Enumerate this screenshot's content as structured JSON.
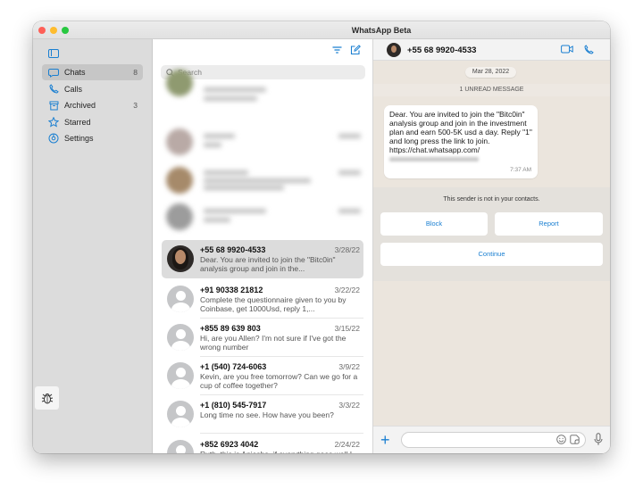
{
  "window": {
    "title": "WhatsApp Beta"
  },
  "sidebar": {
    "items": [
      {
        "label": "Chats",
        "count": "8",
        "icon": "chat-bubble-icon",
        "active": true
      },
      {
        "label": "Calls",
        "count": "",
        "icon": "phone-icon",
        "active": false
      },
      {
        "label": "Archived",
        "count": "3",
        "icon": "archive-box-icon",
        "active": false
      },
      {
        "label": "Starred",
        "count": "",
        "icon": "star-icon",
        "active": false
      },
      {
        "label": "Settings",
        "count": "",
        "icon": "settings-gear-icon",
        "active": false
      }
    ]
  },
  "chat_list": {
    "search_placeholder": "Search",
    "chats": [
      {
        "name": "+55 68 9920-4533",
        "date": "3/28/22",
        "preview": "Dear. You are invited to join the \"Bitc0in\" analysis group and join in the...",
        "selected": true,
        "avatar": "photo"
      },
      {
        "name": "+91 90338 21812",
        "date": "3/22/22",
        "preview": "Complete the questionnaire given to you by Coinbase, get 1000Usd, reply 1,...",
        "selected": false,
        "avatar": "default"
      },
      {
        "name": "+855 89 639 803",
        "date": "3/15/22",
        "preview": "Hi, are you Allen? I'm not sure if I've got the wrong number",
        "selected": false,
        "avatar": "default"
      },
      {
        "name": "+1 (540) 724-6063",
        "date": "3/9/22",
        "preview": "Kevin, are you free tomorrow? Can we go for a cup of coffee together?",
        "selected": false,
        "avatar": "default"
      },
      {
        "name": "+1 (810) 545-7917",
        "date": "3/3/22",
        "preview": "Long time no see. How have you been?",
        "selected": false,
        "avatar": "default"
      },
      {
        "name": "+852 6923 4042",
        "date": "2/24/22",
        "preview": "Ruth, this is Aniesha, if everything goes well I will come to the United States ne...",
        "selected": false,
        "avatar": "default"
      }
    ]
  },
  "conversation": {
    "contact_name": "+55 68 9920-4533",
    "date_label": "Mar 28, 2022",
    "unread_label": "1 UNREAD MESSAGE",
    "message": {
      "text": "Dear. You are invited to join the \"Bitc0in\" analysis group and join in the investment plan and earn 500-5K usd a day. Reply \"1\" and long press the link to join.",
      "link": "https://chat.whatsapp.com/",
      "time": "7:37 AM"
    },
    "notice": {
      "text": "This sender is not in your contacts.",
      "block_label": "Block",
      "report_label": "Report",
      "continue_label": "Continue"
    },
    "composer": {
      "value": ""
    }
  },
  "colors": {
    "accent": "#1a7fd1",
    "sidebar_bg": "#dcdcdc",
    "chat_bg": "#ebe5dd"
  }
}
